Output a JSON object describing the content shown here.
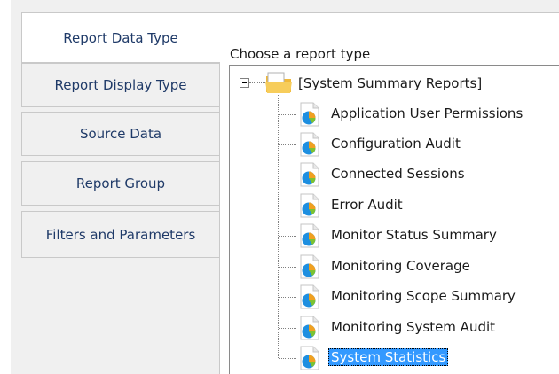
{
  "tabs": [
    {
      "label": "Report Data Type",
      "active": true
    },
    {
      "label": "Report Display Type",
      "active": false
    },
    {
      "label": "Source Data",
      "active": false
    },
    {
      "label": "Report Group",
      "active": false
    },
    {
      "label": "Filters and Parameters",
      "active": false
    }
  ],
  "content": {
    "section_label": "Choose a report type",
    "tree": {
      "root_label": "[System Summary Reports]",
      "root_icon": "folder-icon",
      "root_expanded": true,
      "item_icon": "report-pie-icon",
      "items": [
        {
          "label": "Application User Permissions"
        },
        {
          "label": "Configuration Audit"
        },
        {
          "label": "Connected Sessions"
        },
        {
          "label": "Error Audit"
        },
        {
          "label": "Monitor Status Summary"
        },
        {
          "label": "Monitoring Coverage"
        },
        {
          "label": "Monitoring Scope Summary"
        },
        {
          "label": "Monitoring System Audit"
        },
        {
          "label": "System Statistics",
          "selected": true
        }
      ]
    }
  },
  "colors": {
    "selection": "#3399ff",
    "tab_text": "#1f3a68",
    "folder": "#f5c243"
  }
}
